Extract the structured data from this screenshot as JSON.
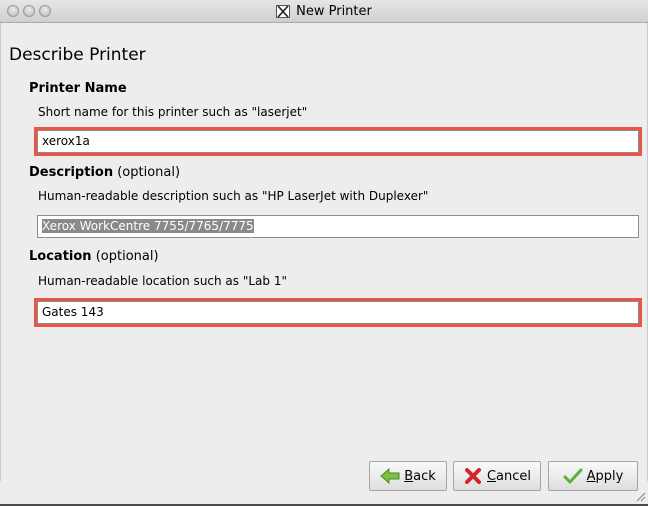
{
  "window": {
    "title": "New Printer"
  },
  "page": {
    "heading": "Describe Printer"
  },
  "printer_name": {
    "label": "Printer Name",
    "hint": "Short name for this printer such as \"laserjet\"",
    "value": "xerox1a"
  },
  "description": {
    "label": "Description",
    "optional": "(optional)",
    "hint": "Human-readable description such as \"HP LaserJet with Duplexer\"",
    "value": "Xerox WorkCentre 7755/7765/7775"
  },
  "location": {
    "label": "Location",
    "optional": "(optional)",
    "hint": "Human-readable location such as \"Lab 1\"",
    "value": "Gates 143"
  },
  "buttons": {
    "back_mnemonic": "B",
    "back_rest": "ack",
    "cancel_mnemonic": "C",
    "cancel_rest": "ancel",
    "apply_mnemonic": "A",
    "apply_rest": "pply"
  },
  "colors": {
    "highlight": "#e8564a"
  },
  "icons": {
    "back": "arrow-left-icon",
    "cancel": "red-x-icon",
    "apply": "green-check-icon"
  }
}
